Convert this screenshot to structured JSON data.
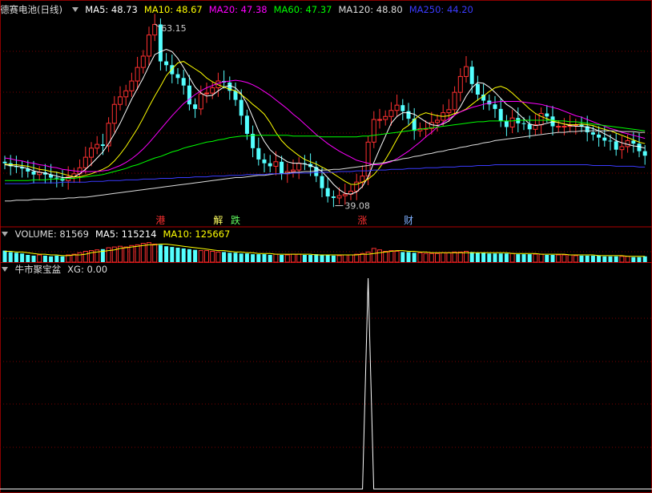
{
  "main_panel": {
    "title": "德赛电池(日线)",
    "ma_labels": [
      {
        "text": "MA5: 48.73",
        "color": "#ffffff"
      },
      {
        "text": "MA10: 48.67",
        "color": "#ffff00"
      },
      {
        "text": "MA20: 47.38",
        "color": "#ff00ff"
      },
      {
        "text": "MA60: 47.37",
        "color": "#00ff00"
      },
      {
        "text": "MA120: 48.80",
        "color": "#dddddd"
      },
      {
        "text": "MA250: 44.20",
        "color": "#3b3bff"
      }
    ],
    "high_label": "63.15",
    "low_label": "39.08",
    "markers": [
      {
        "text": "港",
        "color": "#ff3030",
        "index": 27
      },
      {
        "text": "解",
        "color": "#ffff60",
        "index": 37
      },
      {
        "text": "跌",
        "color": "#60ff60",
        "index": 40
      },
      {
        "text": "涨",
        "color": "#ff3030",
        "index": 62
      },
      {
        "text": "财",
        "color": "#7fb0ff",
        "index": 70
      }
    ]
  },
  "volume_panel": {
    "labels": [
      {
        "text": "VOLUME: 81569",
        "color": "#dddddd"
      },
      {
        "text": "MA5: 115214",
        "color": "#ffffff"
      },
      {
        "text": "MA10: 125667",
        "color": "#ffff00"
      }
    ]
  },
  "indicator_panel": {
    "labels": [
      {
        "text": "牛市聚宝盆",
        "color": "#dddddd"
      },
      {
        "text": "XG: 0.00",
        "color": "#dddddd"
      }
    ]
  },
  "colors": {
    "up": "#ff3030",
    "down": "#54ffff",
    "grid": "#7a0000"
  },
  "chart_data": {
    "type": "candlestick",
    "price_axis": {
      "min": 38.5,
      "max": 64
    },
    "closes": [
      44.7,
      44.3,
      44.2,
      44.0,
      43.6,
      43.2,
      43.5,
      43.2,
      42.8,
      42.7,
      42.4,
      42.9,
      43.3,
      44.1,
      45.5,
      46.7,
      47.2,
      47.0,
      50.0,
      52.5,
      53.5,
      54.3,
      55.6,
      57.4,
      58.9,
      61.7,
      63.1,
      58.2,
      57.7,
      56.5,
      56.0,
      55.0,
      52.5,
      51.9,
      53.9,
      54.0,
      54.7,
      55.6,
      55.4,
      54.3,
      53.1,
      51.0,
      48.6,
      46.7,
      45.2,
      44.7,
      44.3,
      44.9,
      43.3,
      43.6,
      43.8,
      44.7,
      44.6,
      44.2,
      43.0,
      41.4,
      40.3,
      40.1,
      40.4,
      40.6,
      41.0,
      42.2,
      43.0,
      47.5,
      50.5,
      50.5,
      50.9,
      51.7,
      52.4,
      51.6,
      50.6,
      49.0,
      49.3,
      49.3,
      50.1,
      50.4,
      51.4,
      51.8,
      54.1,
      56.2,
      57.5,
      55.2,
      53.8,
      53.0,
      52.5,
      51.9,
      50.3,
      49.5,
      50.7,
      50.0,
      49.9,
      49.2,
      49.8,
      51.3,
      50.9,
      49.6,
      49.6,
      49.6,
      49.7,
      49.8,
      49.6,
      48.8,
      48.5,
      48.1,
      47.7,
      47.6,
      46.5,
      46.9,
      47.7,
      47.3,
      46.3,
      45.7
    ],
    "opens": [
      44.9,
      44.7,
      44.3,
      44.2,
      44.0,
      43.6,
      43.2,
      43.5,
      43.2,
      42.8,
      42.7,
      42.4,
      42.9,
      43.3,
      44.1,
      45.5,
      46.7,
      47.2,
      47.0,
      50.0,
      52.5,
      53.5,
      54.3,
      55.6,
      57.4,
      58.9,
      61.7,
      63.1,
      58.2,
      57.7,
      56.5,
      56.0,
      55.0,
      52.5,
      51.9,
      53.9,
      54.0,
      54.7,
      55.6,
      55.4,
      54.3,
      53.1,
      51.0,
      48.6,
      46.7,
      45.2,
      44.7,
      44.3,
      44.9,
      43.3,
      43.6,
      43.8,
      44.7,
      44.6,
      44.2,
      43.0,
      41.4,
      40.3,
      40.1,
      40.4,
      40.6,
      41.0,
      42.2,
      43.0,
      47.5,
      50.5,
      50.5,
      50.9,
      51.7,
      52.4,
      51.6,
      50.6,
      49.0,
      49.3,
      49.3,
      50.1,
      50.4,
      51.4,
      51.8,
      54.1,
      56.2,
      57.5,
      55.2,
      53.8,
      53.0,
      52.5,
      51.9,
      50.3,
      49.5,
      50.7,
      50.0,
      49.9,
      49.2,
      49.8,
      51.3,
      50.9,
      49.6,
      49.6,
      49.6,
      49.7,
      49.8,
      49.6,
      48.8,
      48.5,
      48.1,
      47.7,
      47.6,
      46.5,
      46.9,
      47.7,
      47.3,
      46.3
    ],
    "ma_series": [
      {
        "name": "MA5",
        "color": "#ffffff",
        "values": [
          44.5,
          44.4,
          44.3,
          44.2,
          44.0,
          43.7,
          43.5,
          43.4,
          43.2,
          43.0,
          42.8,
          42.8,
          42.9,
          43.3,
          43.9,
          44.6,
          45.4,
          46.2,
          47.3,
          48.6,
          50.0,
          51.6,
          53.2,
          54.6,
          56.0,
          57.6,
          59.1,
          59.5,
          59.8,
          59.5,
          58.6,
          57.4,
          56.1,
          54.8,
          54.0,
          53.6,
          53.7,
          54.3,
          54.8,
          55.0,
          54.7,
          53.9,
          52.6,
          50.8,
          49.0,
          47.6,
          46.5,
          45.8,
          45.4,
          44.9,
          44.7,
          44.7,
          44.6,
          44.4,
          44.1,
          43.6,
          42.8,
          41.9,
          41.2,
          40.7,
          40.6,
          40.9,
          41.6,
          42.9,
          44.8,
          46.6,
          48.3,
          50.0,
          50.9,
          51.4,
          51.4,
          51.2,
          50.7,
          50.2,
          49.8,
          49.7,
          49.9,
          50.3,
          51.1,
          52.2,
          53.6,
          54.7,
          55.4,
          55.3,
          54.8,
          54.1,
          53.3,
          52.5,
          52.0,
          51.3,
          50.6,
          49.9,
          49.7,
          49.8,
          50.0,
          50.2,
          50.1,
          49.9,
          49.7,
          49.6,
          49.6,
          49.5,
          49.3,
          49.0,
          48.6,
          48.2,
          47.7,
          47.4,
          47.2,
          47.0,
          46.9,
          46.7
        ]
      },
      {
        "name": "MA10",
        "color": "#ffff00",
        "values": [
          44.6,
          44.5,
          44.5,
          44.4,
          44.3,
          44.1,
          43.9,
          43.8,
          43.6,
          43.5,
          43.3,
          43.1,
          42.9,
          42.9,
          43.1,
          43.3,
          43.6,
          43.9,
          44.3,
          45.0,
          45.9,
          46.9,
          48.1,
          49.3,
          50.7,
          52.2,
          53.6,
          54.9,
          56.3,
          57.2,
          58.0,
          58.2,
          57.7,
          57.2,
          56.7,
          56.0,
          55.5,
          55.1,
          54.8,
          54.5,
          54.3,
          53.8,
          53.2,
          52.5,
          51.9,
          51.2,
          50.1,
          48.8,
          47.7,
          46.9,
          46.3,
          45.7,
          45.2,
          44.9,
          44.6,
          44.2,
          43.8,
          43.3,
          42.8,
          42.3,
          41.9,
          41.9,
          42.2,
          42.6,
          43.2,
          44.1,
          45.2,
          46.5,
          47.9,
          49.2,
          49.7,
          50.5,
          51.1,
          51.4,
          51.2,
          51.0,
          50.9,
          51.0,
          51.3,
          51.5,
          51.9,
          52.5,
          53.1,
          53.6,
          54.2,
          54.7,
          54.9,
          54.6,
          54.0,
          53.3,
          52.6,
          51.9,
          51.3,
          50.9,
          50.6,
          50.3,
          50.1,
          49.9,
          49.8,
          49.8,
          49.9,
          49.8,
          49.7,
          49.4,
          49.2,
          49.0,
          48.7,
          48.4,
          48.1,
          47.8,
          47.5,
          47.3
        ]
      },
      {
        "name": "MA20",
        "color": "#ff00ff",
        "values": [
          45.4,
          45.3,
          45.1,
          45.0,
          44.8,
          44.7,
          44.5,
          44.4,
          44.2,
          44.1,
          43.9,
          43.8,
          43.7,
          43.6,
          43.6,
          43.6,
          43.6,
          43.7,
          43.8,
          44.1,
          44.4,
          44.8,
          45.3,
          45.9,
          46.6,
          47.4,
          48.3,
          49.2,
          50.1,
          51.0,
          51.8,
          52.6,
          53.2,
          53.8,
          54.3,
          54.7,
          55.0,
          55.3,
          55.5,
          55.6,
          55.7,
          55.6,
          55.4,
          55.1,
          54.7,
          54.2,
          53.7,
          53.1,
          52.5,
          51.9,
          51.2,
          50.6,
          49.9,
          49.2,
          48.5,
          47.9,
          47.3,
          46.8,
          46.3,
          45.9,
          45.5,
          45.1,
          44.9,
          44.7,
          44.5,
          44.5,
          44.7,
          44.9,
          45.3,
          45.8,
          46.3,
          46.9,
          47.5,
          48.2,
          48.8,
          49.5,
          50.1,
          50.6,
          51.1,
          51.5,
          51.8,
          52.1,
          52.3,
          52.5,
          52.7,
          52.8,
          52.9,
          52.9,
          52.9,
          52.9,
          52.8,
          52.7,
          52.6,
          52.5,
          52.3,
          52.1,
          51.9,
          51.6,
          51.3,
          51.0,
          50.8,
          50.5,
          50.2,
          49.9,
          49.6,
          49.3,
          49.1,
          48.8,
          48.6,
          48.4,
          48.2,
          48.0
        ]
      },
      {
        "name": "MA60",
        "color": "#00ff00",
        "values": [
          42.4,
          42.4,
          42.4,
          42.4,
          42.4,
          42.5,
          42.5,
          42.5,
          42.6,
          42.6,
          42.6,
          42.7,
          42.7,
          42.8,
          42.9,
          43.0,
          43.1,
          43.2,
          43.4,
          43.6,
          43.8,
          44.0,
          44.3,
          44.5,
          44.8,
          45.1,
          45.4,
          45.6,
          45.9,
          46.2,
          46.4,
          46.7,
          46.9,
          47.1,
          47.3,
          47.5,
          47.6,
          47.8,
          47.9,
          48.1,
          48.2,
          48.3,
          48.3,
          48.4,
          48.4,
          48.4,
          48.4,
          48.4,
          48.4,
          48.4,
          48.3,
          48.3,
          48.3,
          48.3,
          48.3,
          48.2,
          48.2,
          48.2,
          48.2,
          48.2,
          48.2,
          48.2,
          48.3,
          48.3,
          48.4,
          48.5,
          48.6,
          48.7,
          48.8,
          48.9,
          49.0,
          49.1,
          49.2,
          49.3,
          49.4,
          49.5,
          49.6,
          49.7,
          49.8,
          49.9,
          50.0,
          50.1,
          50.2,
          50.2,
          50.3,
          50.3,
          50.3,
          50.3,
          50.3,
          50.4,
          50.4,
          50.4,
          50.4,
          50.4,
          50.4,
          50.4,
          50.3,
          50.3,
          50.2,
          50.2,
          50.1,
          50.0,
          49.9,
          49.8,
          49.7,
          49.6,
          49.5,
          49.4,
          49.3,
          49.2,
          49.1,
          49.0
        ]
      },
      {
        "name": "MA120",
        "color": "#dddddd",
        "values": [
          39.7,
          39.7,
          39.8,
          39.8,
          39.8,
          39.9,
          39.9,
          39.9,
          40.0,
          40.0,
          40.0,
          40.1,
          40.1,
          40.2,
          40.2,
          40.3,
          40.4,
          40.5,
          40.6,
          40.7,
          40.8,
          40.9,
          41.0,
          41.1,
          41.2,
          41.3,
          41.4,
          41.5,
          41.6,
          41.7,
          41.8,
          41.9,
          42.0,
          42.1,
          42.2,
          42.3,
          42.4,
          42.5,
          42.6,
          42.7,
          42.8,
          42.8,
          42.9,
          43.0,
          43.1,
          43.1,
          43.2,
          43.3,
          43.3,
          43.4,
          43.5,
          43.5,
          43.6,
          43.6,
          43.7,
          43.8,
          43.8,
          43.9,
          43.9,
          44.0,
          44.1,
          44.2,
          44.3,
          44.4,
          44.6,
          44.7,
          44.8,
          45.0,
          45.1,
          45.3,
          45.4,
          45.6,
          45.7,
          45.9,
          46.0,
          46.2,
          46.3,
          46.5,
          46.6,
          46.8,
          46.9,
          47.1,
          47.2,
          47.4,
          47.5,
          47.7,
          47.8,
          47.9,
          48.0,
          48.1,
          48.2,
          48.3,
          48.4,
          48.5,
          48.6,
          48.7,
          48.8,
          48.8,
          48.9,
          48.9,
          49.0,
          49.0,
          49.0,
          49.0,
          49.0,
          49.0,
          49.0,
          48.9,
          48.9,
          48.9,
          48.8,
          48.8
        ]
      },
      {
        "name": "MA250",
        "color": "#3b3bff",
        "values": [
          42.0,
          42.0,
          42.0,
          42.0,
          42.0,
          42.1,
          42.1,
          42.1,
          42.1,
          42.1,
          42.2,
          42.2,
          42.2,
          42.2,
          42.2,
          42.3,
          42.3,
          42.3,
          42.4,
          42.4,
          42.4,
          42.5,
          42.5,
          42.5,
          42.6,
          42.6,
          42.6,
          42.7,
          42.7,
          42.7,
          42.8,
          42.8,
          42.8,
          42.9,
          42.9,
          42.9,
          43.0,
          43.0,
          43.0,
          43.1,
          43.1,
          43.1,
          43.2,
          43.2,
          43.2,
          43.2,
          43.3,
          43.3,
          43.3,
          43.3,
          43.4,
          43.4,
          43.4,
          43.4,
          43.5,
          43.5,
          43.5,
          43.5,
          43.6,
          43.6,
          43.6,
          43.7,
          43.7,
          43.7,
          43.8,
          43.8,
          43.8,
          43.9,
          43.9,
          43.9,
          44.0,
          44.0,
          44.0,
          44.1,
          44.1,
          44.1,
          44.2,
          44.2,
          44.2,
          44.3,
          44.3,
          44.3,
          44.4,
          44.4,
          44.4,
          44.5,
          44.5,
          44.5,
          44.5,
          44.5,
          44.5,
          44.5,
          44.5,
          44.5,
          44.5,
          44.5,
          44.5,
          44.5,
          44.5,
          44.5,
          44.5,
          44.5,
          44.4,
          44.4,
          44.4,
          44.4,
          44.3,
          44.3,
          44.3,
          44.3,
          44.2,
          44.2
        ]
      }
    ],
    "volume": {
      "axis_max": 30,
      "values": [
        16,
        14,
        13,
        12,
        10,
        9,
        10,
        9,
        8,
        9,
        8,
        10,
        11,
        13,
        15,
        16,
        17,
        18,
        20,
        21,
        22,
        21,
        23,
        24,
        26,
        27,
        25,
        24,
        22,
        21,
        20,
        19,
        18,
        17,
        16,
        16,
        15,
        14,
        14,
        13,
        13,
        12,
        12,
        11,
        11,
        11,
        10,
        11,
        10,
        10,
        11,
        11,
        10,
        10,
        11,
        10,
        10,
        9,
        9,
        10,
        10,
        11,
        12,
        14,
        19,
        17,
        15,
        16,
        15,
        14,
        14,
        13,
        13,
        12,
        12,
        12,
        13,
        13,
        14,
        14,
        15,
        14,
        13,
        13,
        12,
        12,
        12,
        12,
        12,
        11,
        11,
        11,
        11,
        11,
        10,
        10,
        10,
        10,
        10,
        9,
        9,
        9,
        9,
        9,
        8,
        8,
        8,
        8,
        8,
        7,
        7,
        8
      ],
      "ma_values": [
        15,
        15,
        14,
        14,
        13,
        12,
        11,
        11,
        10,
        10,
        9,
        9,
        10,
        10,
        11,
        13,
        14,
        15,
        16,
        17,
        19,
        20,
        21,
        22,
        23,
        24,
        24,
        25,
        25,
        24,
        23,
        22,
        21,
        20,
        19,
        18,
        17,
        16,
        16,
        15,
        14,
        14,
        13,
        13,
        12,
        12,
        12,
        11,
        11,
        11,
        11,
        11,
        11,
        11,
        10,
        10,
        10,
        10,
        10,
        10,
        10,
        10,
        11,
        11,
        12,
        13,
        14,
        15,
        16,
        16,
        15,
        15,
        14,
        14,
        13,
        13,
        13,
        13,
        13,
        13,
        13,
        13,
        13,
        13,
        13,
        13,
        13,
        13,
        12,
        12,
        12,
        12,
        12,
        11,
        11,
        11,
        11,
        11,
        10,
        10,
        10,
        10,
        10,
        9,
        9,
        9,
        9,
        9,
        8,
        8,
        8,
        8
      ]
    },
    "xg": {
      "peak_index": 63,
      "peak_value": 1
    }
  }
}
